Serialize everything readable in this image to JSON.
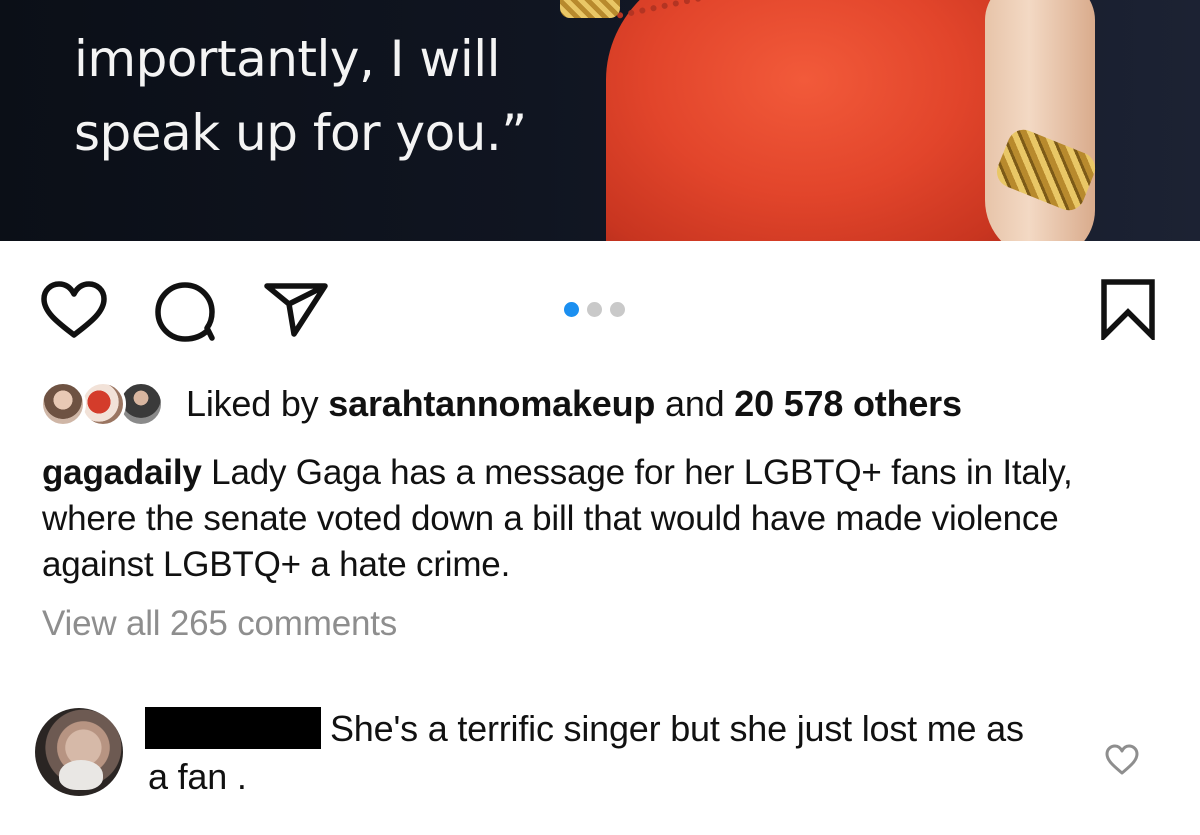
{
  "post": {
    "image_quote_lines": [
      "importantly, I will",
      "speak up for you.”"
    ],
    "carousel": {
      "total": 3,
      "active_index": 0
    }
  },
  "colors": {
    "accent_dot": "#1b8ff0",
    "muted_text": "#8e8e8e",
    "text": "#111111"
  },
  "actions": {
    "like_icon": "heart-outline-icon",
    "comment_icon": "comment-bubble-icon",
    "share_icon": "paper-plane-icon",
    "save_icon": "bookmark-outline-icon"
  },
  "likes": {
    "prefix": "Liked by ",
    "user": "sarahtannomakeup",
    "middle": " and ",
    "others": "20 578 others"
  },
  "caption": {
    "username": "gagadaily",
    "text": " Lady Gaga has a message for her LGBTQ+ fans in Italy, where the senate voted down a bill that would have made violence against LGBTQ+ a hate crime."
  },
  "view_all_comments": "View all 265 comments",
  "comment": {
    "text": "She's a terrific singer but she just lost me as a fan .",
    "like_icon": "heart-outline-icon"
  }
}
